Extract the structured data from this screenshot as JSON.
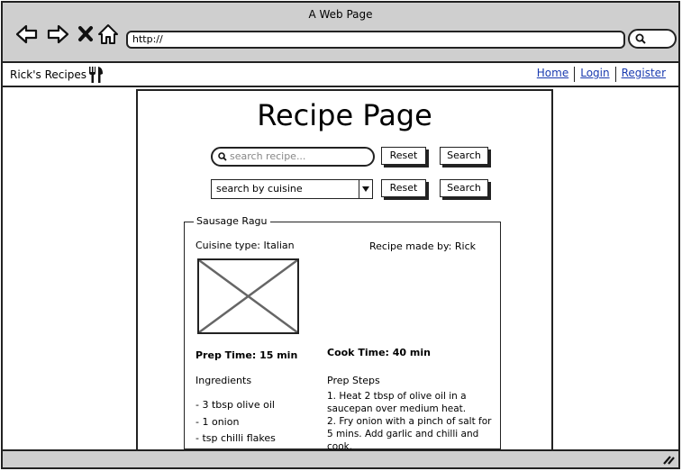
{
  "window": {
    "title": "A Web Page"
  },
  "address_bar": {
    "url": "http://"
  },
  "site": {
    "brand": "Rick's Recipes",
    "nav": [
      {
        "label": "Home"
      },
      {
        "label": "Login"
      },
      {
        "label": "Register"
      }
    ]
  },
  "main": {
    "title": "Recipe Page",
    "search": {
      "placeholder": "search recipe..."
    },
    "cuisine_select": {
      "value": "search by cuisine"
    },
    "buttons": {
      "reset": "Reset",
      "search": "Search"
    }
  },
  "recipe": {
    "name": "Sausage Ragu",
    "cuisine": "Cuisine type: Italian",
    "author": "Recipe made by: Rick",
    "prep_time": "Prep Time: 15 min",
    "cook_time": "Cook Time: 40 min",
    "ingredients_heading": "Ingredients",
    "ingredients": [
      "- 3 tbsp olive oil",
      "- 1 onion",
      "- tsp chilli flakes"
    ],
    "steps_heading": "Prep Steps",
    "steps": [
      "1. Heat 2 tbsp of olive oil in a saucepan over medium heat.",
      "2. Fry onion with a pinch of salt for 5 mins. Add garlic and chilli and cook."
    ]
  },
  "icons": {
    "back": "back-arrow-icon",
    "forward": "forward-arrow-icon",
    "stop": "close-icon",
    "home": "home-icon",
    "search": "search-icon",
    "brand": "fork-knife-icon",
    "dropdown": "chevron-down-icon",
    "resize": "resize-grip-icon"
  },
  "colors": {
    "chrome": "#cfcfcf",
    "link": "#1a3bb0",
    "border": "#222222"
  }
}
